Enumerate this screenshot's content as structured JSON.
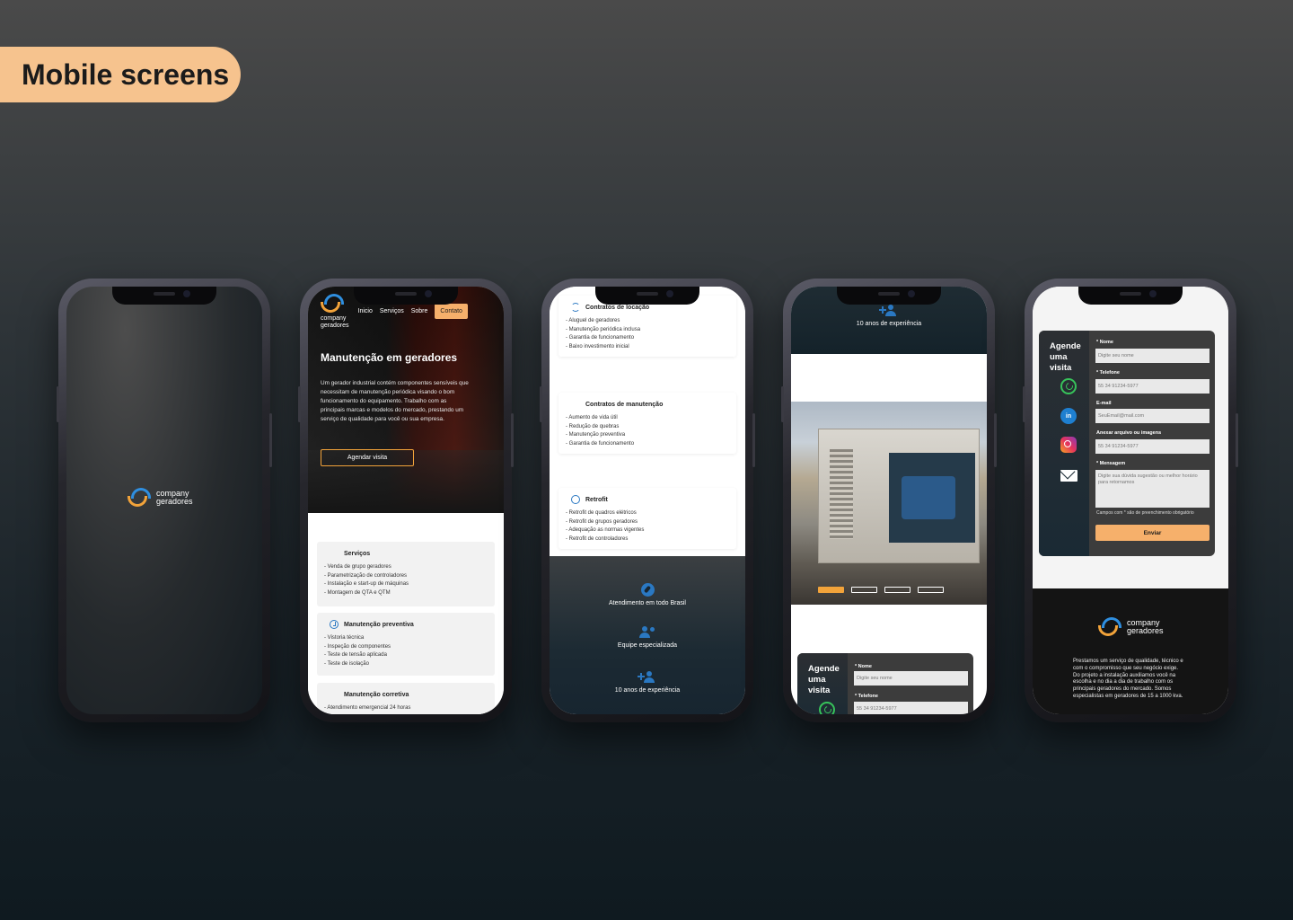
{
  "badge": "Mobile screens",
  "brand": {
    "line1": "company",
    "line2": "geradores"
  },
  "nav": {
    "inicio": "Inicio",
    "servicos": "Serviços",
    "sobre": "Sobre",
    "contato": "Contato"
  },
  "hero": {
    "title": "Manutenção em geradores",
    "text": "Um gerador industrial contém componentes sensíveis que necessitam de manutenção periódica visando o bom funcionamento do equipamento. Trabalho com as principais marcas e modelos do mercado, prestando um serviço de qualidade para você ou sua empresa.",
    "cta": "Agendar visita"
  },
  "services": [
    {
      "title": "Serviços",
      "items": [
        "Venda de grupo geradores",
        "Parametrização de controladores",
        "Instalação e start-up de máquinas",
        "Montagem de QTA e QTM"
      ]
    },
    {
      "title": "Manutenção preventiva",
      "items": [
        "Vistoria técnica",
        "Inspeção de componentes",
        "Teste de tensão aplicada",
        "Teste de isolação"
      ]
    },
    {
      "title": "Manutenção corretiva",
      "items": [
        "Atendimento emergencial 24 horas"
      ]
    },
    {
      "title": "Contratos de locação",
      "items": [
        "Aluguel de geradores",
        "Manutenção periódica inclusa",
        "Garantia de funcionamento",
        "Baixo investimento inicial"
      ]
    },
    {
      "title": "Contratos de manutenção",
      "items": [
        "Aumento de vida útil",
        "Redução de quebras",
        "Manutenção preventiva",
        "Garantia de funcionamento"
      ]
    },
    {
      "title": "Retrofit",
      "items": [
        "Retrofit de quadros elétricos",
        "Retrofit de grupos geradores",
        "Adequação as normas vigentes",
        "Retrofit de controladores"
      ]
    }
  ],
  "features": {
    "brasil": "Atendimento em todo Brasil",
    "equipe": "Equipe especializada",
    "anos": "10 anos de experiência"
  },
  "form": {
    "title_l1": "Agende",
    "title_l2": "uma",
    "title_l3": "visita",
    "nome_label": "* Nome",
    "nome_ph": "Digite seu nome",
    "tel_label": "* Telefone",
    "tel_ph": "55 34 91234-5977",
    "email_label": "E-mail",
    "email_ph": "SeuEmail@mail.com",
    "anexo_label": "Anexar arquivo ou imagens",
    "anexo_ph": "55 34 91234-5977",
    "msg_label": "* Mensagem",
    "msg_ph": "Digite sua dúvida sugestão ou melhor horário para retornamos",
    "note": "Campos com * são de preenchimento obrigatório",
    "submit": "Enviar",
    "linkedin": "in"
  },
  "footer": {
    "text": "Prestamos um serviço de qualidade, técnico e com o compromisso que seu negócio exige. Do projeto a instalação auxiliamos você na escolha e no dia a dia de trabalho com os principais geradores do mercado. Somos especialistas em geradores de 15 a 1000 kva."
  },
  "colors": {
    "accent": "#f2a33a",
    "blue": "#2a78c2",
    "button": "#f6b06b"
  }
}
